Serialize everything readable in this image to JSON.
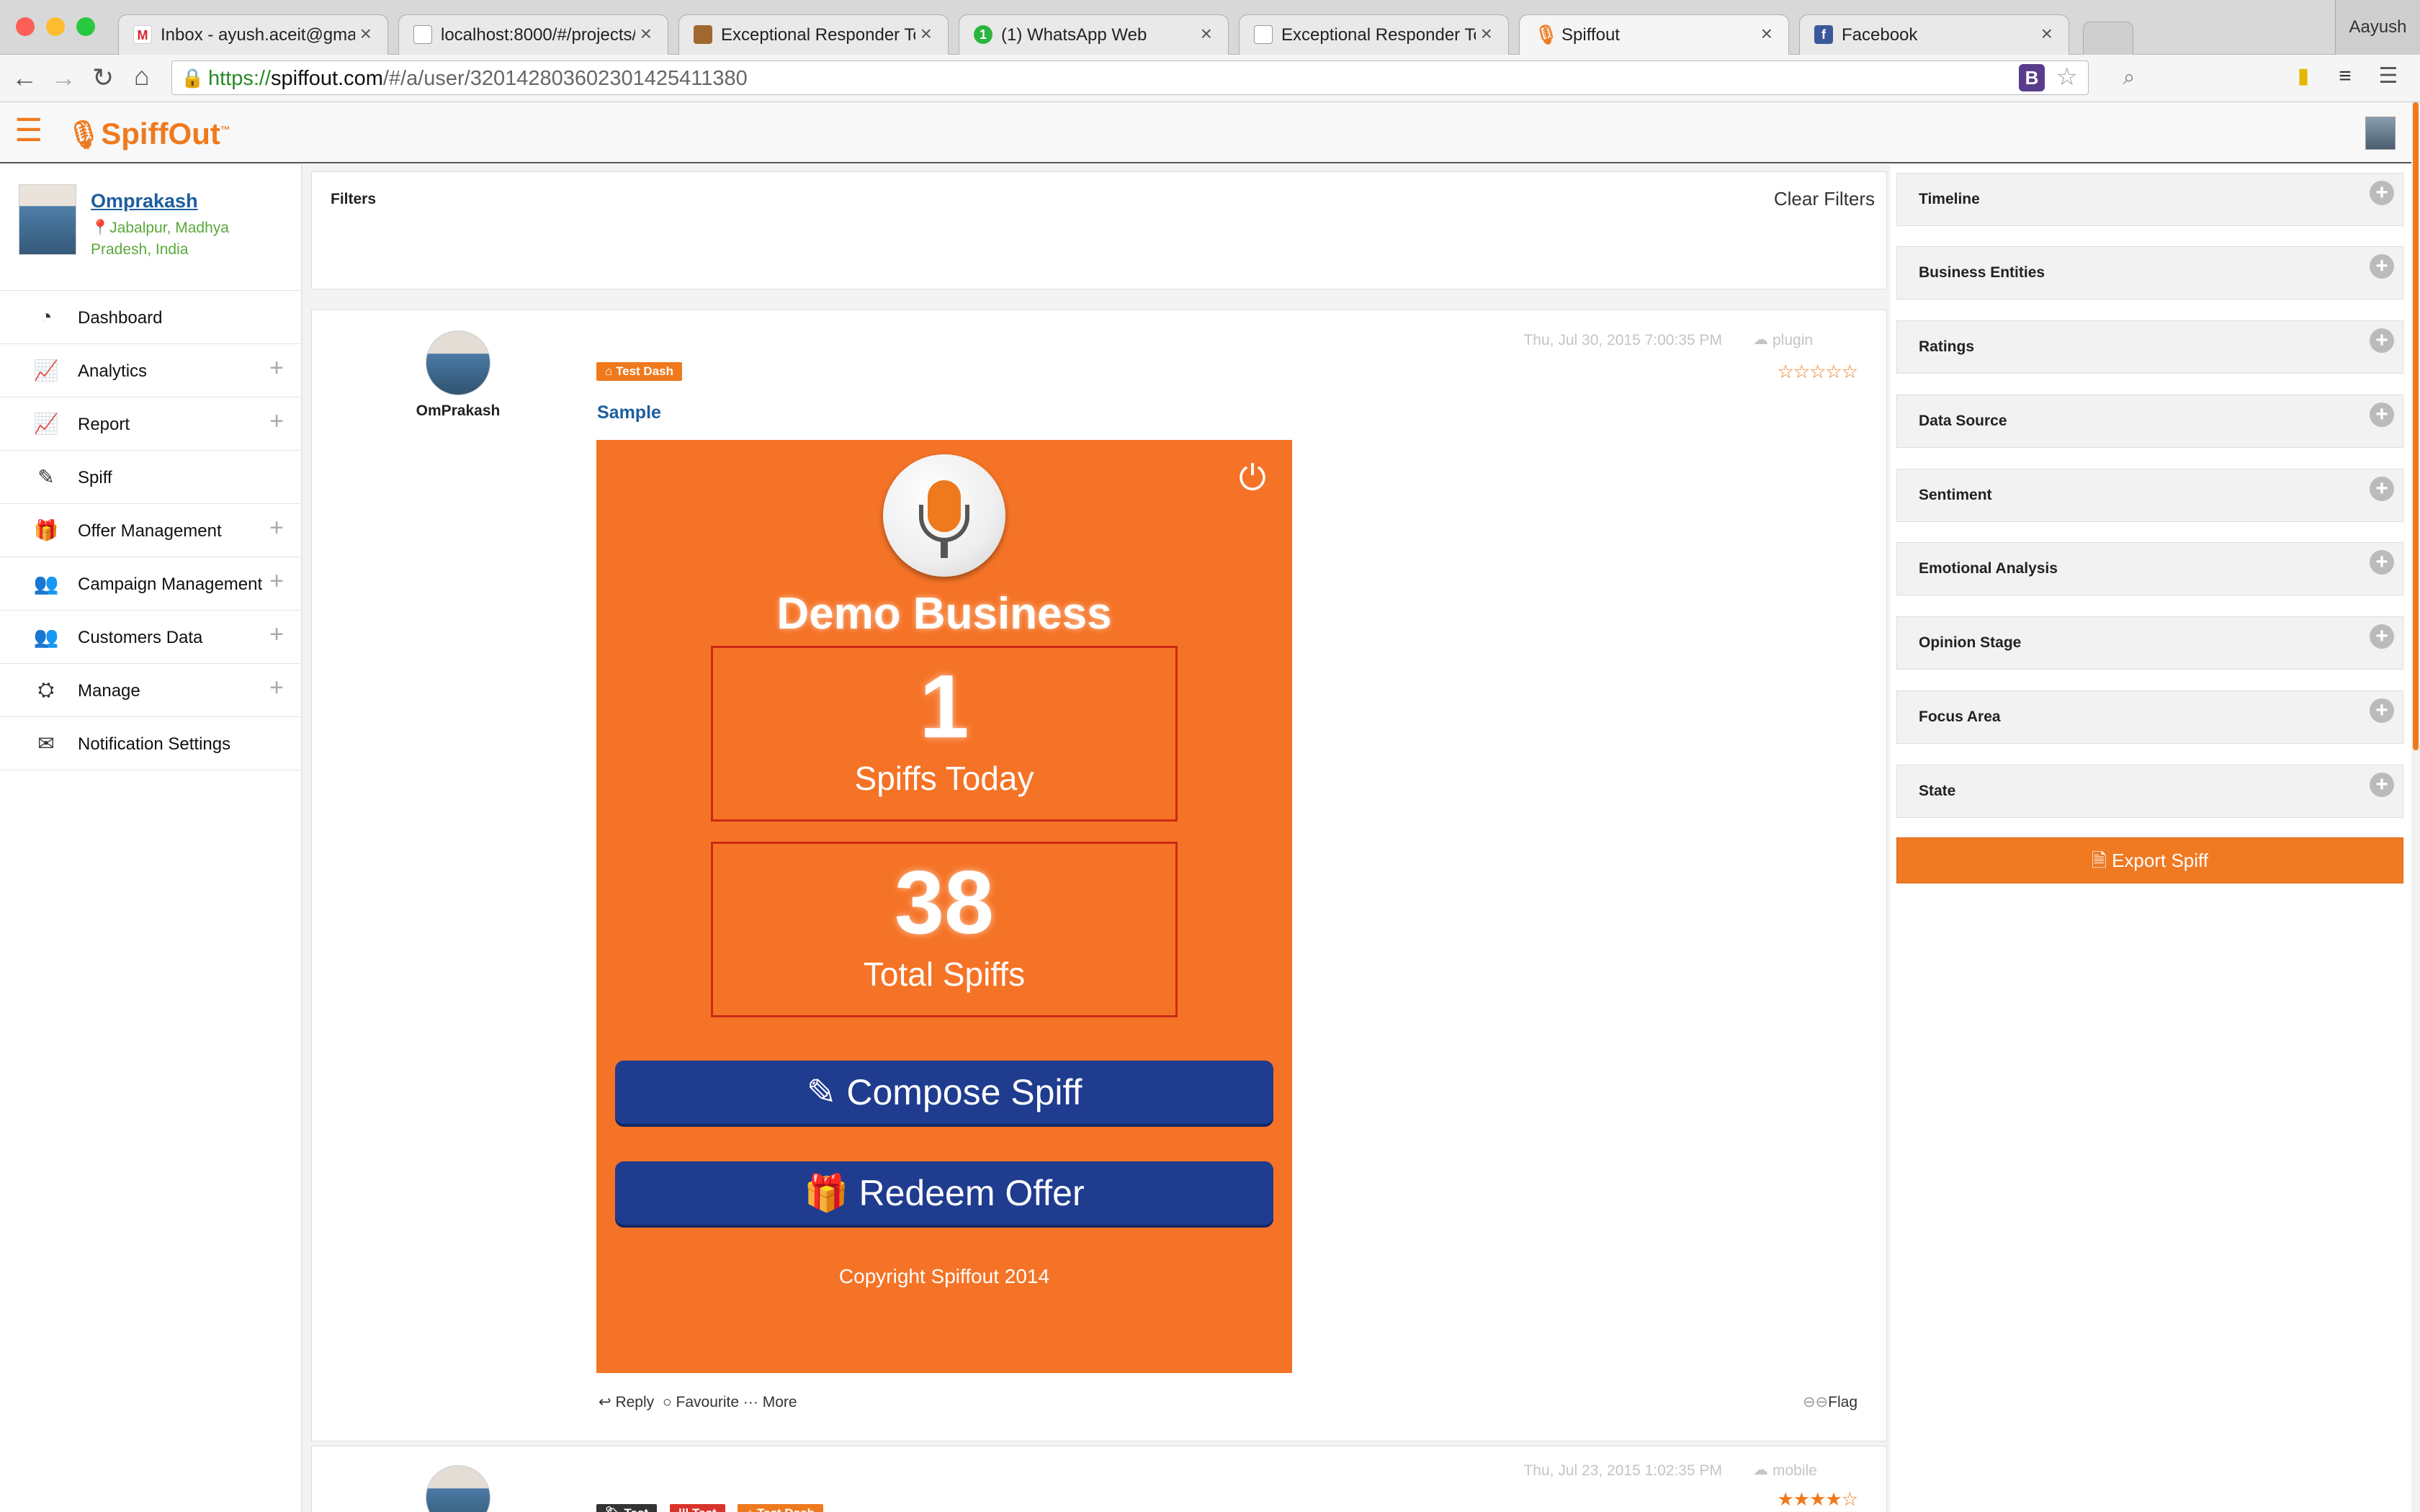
{
  "browser": {
    "tabs": [
      {
        "title": "Inbox - ayush.aceit@gmail.",
        "icon": "gmail-icon"
      },
      {
        "title": "localhost:8000/#/projects/",
        "icon": "page-icon"
      },
      {
        "title": "Exceptional Responder Too",
        "icon": "responder-icon"
      },
      {
        "title": "(1) WhatsApp Web",
        "icon": "whatsapp-icon"
      },
      {
        "title": "Exceptional Responder Too",
        "icon": "page-icon"
      },
      {
        "title": "Spiffout",
        "icon": "spiffout-icon"
      },
      {
        "title": "Facebook",
        "icon": "facebook-icon"
      }
    ],
    "active_tab": 5,
    "profile": "Aayush",
    "url_scheme": "https://",
    "url_domain": "spiffout.com",
    "url_path": "/#/a/user/320142803602301425411380"
  },
  "app": {
    "logo_text": "SpiffOut",
    "logo_tm": "™"
  },
  "user": {
    "name": "Omprakash",
    "location": "Jabalpur, Madhya Pradesh, India"
  },
  "menu": [
    {
      "label": "Dashboard",
      "icon": "dashboard-icon",
      "expand": false
    },
    {
      "label": "Analytics",
      "icon": "chart-line-icon",
      "expand": true
    },
    {
      "label": "Report",
      "icon": "report-icon",
      "expand": true
    },
    {
      "label": "Spiff",
      "icon": "edit-icon",
      "expand": false
    },
    {
      "label": "Offer Management",
      "icon": "gift-icon",
      "expand": true
    },
    {
      "label": "Campaign Management",
      "icon": "users-icon",
      "expand": true
    },
    {
      "label": "Customers Data",
      "icon": "users-icon",
      "expand": true
    },
    {
      "label": "Manage",
      "icon": "sitemap-icon",
      "expand": true
    },
    {
      "label": "Notification Settings",
      "icon": "envelope-icon",
      "expand": false
    }
  ],
  "filters": {
    "title": "Filters",
    "clear_label": "Clear Filters"
  },
  "post1": {
    "author": "OmPrakash",
    "timestamp": "Thu, Jul 30, 2015 7:00:35 PM",
    "source": "plugin",
    "tag": "Test Dash",
    "title": "Sample",
    "rating": 0,
    "actions": {
      "reply": "Reply",
      "favourite": "Favourite",
      "more": "More",
      "flag": "Flag"
    }
  },
  "spiff_card": {
    "business": "Demo Business",
    "today_value": "1",
    "today_label": "Spiffs Today",
    "total_value": "38",
    "total_label": "Total Spiffs",
    "compose_label": "Compose Spiff",
    "redeem_label": "Redeem Offer",
    "copyright": "Copyright Spiffout 2014",
    "accent": "#f57326",
    "button_color": "#1f3c8f"
  },
  "post2": {
    "timestamp": "Thu, Jul 23, 2015 1:02:35 PM",
    "source": "mobile",
    "tags": [
      "Test",
      "Test",
      "Test Dash"
    ],
    "rating": 4
  },
  "right_panels": [
    "Timeline",
    "Business Entities",
    "Ratings",
    "Data Source",
    "Sentiment",
    "Emotional Analysis",
    "Opinion Stage",
    "Focus Area",
    "State"
  ],
  "export_label": "Export Spiff",
  "colors": {
    "brand": "#ef7a1e",
    "link": "#1d5e9e",
    "location": "#5aa83a"
  }
}
